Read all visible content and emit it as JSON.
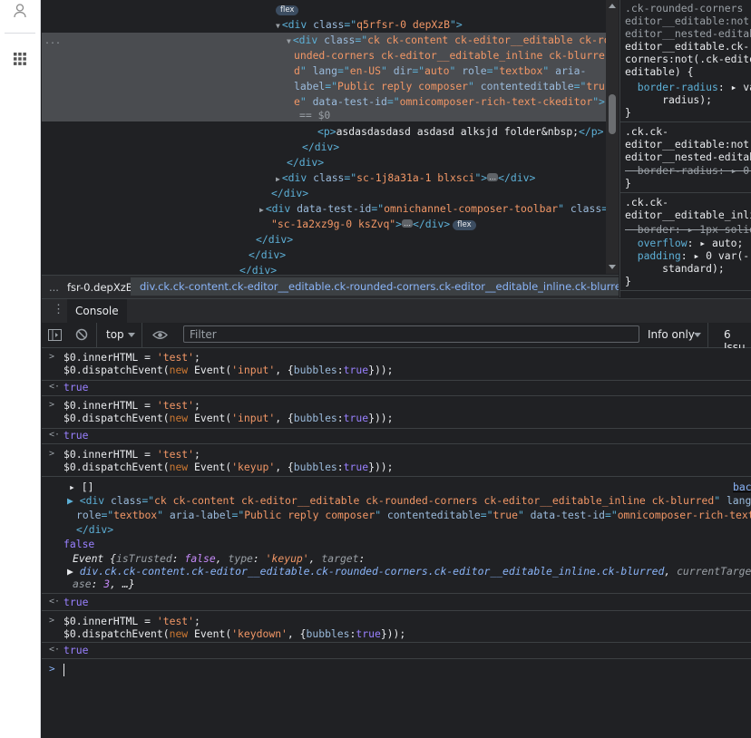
{
  "elements": {
    "lines": [
      {
        "indent": "",
        "pre": "",
        "parts": [],
        "badge": "flex"
      },
      {
        "indent": "",
        "pre": "▼",
        "parts": [
          [
            "tag",
            "<div "
          ],
          [
            "attr",
            "class"
          ],
          [
            "tag",
            "=\""
          ],
          [
            "val",
            "q5rfsr-0 depXzB"
          ],
          [
            "tag",
            "\">"
          ]
        ]
      },
      {
        "indent": "",
        "pre": "▼",
        "parts": [
          [
            "tag",
            "<div "
          ],
          [
            "attr",
            "class"
          ],
          [
            "tag",
            "=\""
          ],
          [
            "val",
            "ck ck-content ck-editor__editable ck-ro"
          ]
        ]
      },
      {
        "indent": "",
        "pre": "",
        "parts": [
          [
            "val",
            "unded-corners ck-editor__editable_inline ck-blurre"
          ]
        ]
      },
      {
        "indent": "",
        "pre": "",
        "parts": [
          [
            "val",
            "d"
          ],
          [
            "tag",
            "\" "
          ],
          [
            "attr",
            "lang"
          ],
          [
            "tag",
            "=\""
          ],
          [
            "val",
            "en-US"
          ],
          [
            "tag",
            "\" "
          ],
          [
            "attr",
            "dir"
          ],
          [
            "tag",
            "=\""
          ],
          [
            "val",
            "auto"
          ],
          [
            "tag",
            "\" "
          ],
          [
            "attr",
            "role"
          ],
          [
            "tag",
            "=\""
          ],
          [
            "val",
            "textbox"
          ],
          [
            "tag",
            "\" "
          ],
          [
            "attr",
            "aria-"
          ]
        ]
      },
      {
        "indent": "",
        "pre": "",
        "parts": [
          [
            "attr",
            "label"
          ],
          [
            "tag",
            "=\""
          ],
          [
            "val",
            "Public reply composer"
          ],
          [
            "tag",
            "\" "
          ],
          [
            "attr",
            "contenteditable"
          ],
          [
            "tag",
            "=\""
          ],
          [
            "val",
            "tru"
          ]
        ]
      },
      {
        "indent": "",
        "pre": "",
        "parts": [
          [
            "val",
            "e"
          ],
          [
            "tag",
            "\" "
          ],
          [
            "attr",
            "data-test-id"
          ],
          [
            "tag",
            "=\""
          ],
          [
            "val",
            "omnicomposer-rich-text-ckeditor"
          ],
          [
            "tag",
            "\">"
          ]
        ]
      },
      {
        "indent": "",
        "pre": "",
        "parts": [
          [
            "cm",
            "== $0"
          ]
        ]
      },
      {
        "indent": "",
        "pre": "",
        "parts": [
          [
            "tag",
            "<p>"
          ],
          [
            "txt",
            "asdasdasdasd asdasd alksjd folder&nbsp;"
          ],
          [
            "tag",
            "</p>"
          ]
        ]
      },
      {
        "indent": "",
        "pre": "",
        "parts": [
          [
            "tag",
            "</div>"
          ]
        ]
      },
      {
        "indent": "",
        "pre": "",
        "parts": [
          [
            "tag",
            "</div>"
          ]
        ]
      },
      {
        "indent": "",
        "pre": "▶",
        "parts": [
          [
            "tag",
            "<div "
          ],
          [
            "attr",
            "class"
          ],
          [
            "tag",
            "=\""
          ],
          [
            "val",
            "sc-1j8a31a-1 blxsci"
          ],
          [
            "tag",
            "\">"
          ]
        ],
        "ell": true,
        "after": [
          [
            "tag",
            "</div>"
          ]
        ]
      },
      {
        "indent": "",
        "pre": "",
        "parts": [
          [
            "tag",
            "</div>"
          ]
        ]
      },
      {
        "indent": "",
        "pre": "▶",
        "parts": [
          [
            "tag",
            "<div "
          ],
          [
            "attr",
            "data-test-id"
          ],
          [
            "tag",
            "=\""
          ],
          [
            "val",
            "omnichannel-composer-toolbar"
          ],
          [
            "tag",
            "\" "
          ],
          [
            "attr",
            "class"
          ],
          [
            "tag",
            "="
          ]
        ]
      },
      {
        "indent": "",
        "pre": "",
        "parts": [
          [
            "val",
            "\"sc-1a2xz9g-0 ksZvq\""
          ],
          [
            "tag",
            ">"
          ]
        ],
        "ell": true,
        "after": [
          [
            "tag",
            "</div>"
          ]
        ],
        "badge": "flex"
      },
      {
        "indent": "",
        "pre": "",
        "parts": [
          [
            "tag",
            "</div>"
          ]
        ]
      },
      {
        "indent": "",
        "pre": "",
        "parts": [
          [
            "tag",
            "</div>"
          ]
        ]
      },
      {
        "indent": "",
        "pre": "",
        "parts": [
          [
            "tag",
            "</div>"
          ]
        ]
      }
    ],
    "row_dots": "...",
    "ellipsis": "…"
  },
  "breadcrumbs": {
    "dots": "...",
    "items": [
      "fsr-0.depXzB",
      "div.ck.ck-content.ck-editor__editable.ck-rounded-corners.ck-editor__editable_inline.ck-blurred"
    ]
  },
  "styles": {
    "lines": [
      {
        "cls": "sel-g",
        "t": ".ck-rounded-corners ."
      },
      {
        "cls": "sel-g",
        "t": "editor__editable:not("
      },
      {
        "cls": "sel-g",
        "t": "editor__nested-editab"
      },
      {
        "cls": "sel-w",
        "t": "editor__editable.ck-r"
      },
      {
        "cls": "sel-w",
        "t": "corners:not(.ck-edito"
      },
      {
        "cls": "sel-w",
        "t": "editable) {"
      },
      {
        "cls": "prop",
        "t": "  border-radius: ▸ var"
      },
      {
        "cls": "prop",
        "t": "      radius);"
      },
      {
        "cls": "sel-w",
        "t": "}"
      },
      {
        "cls": "sel-w",
        "t": ".ck.ck-"
      },
      {
        "cls": "sel-w",
        "t": "editor__editable:not("
      },
      {
        "cls": "sel-w",
        "t": "editor__nested-editab"
      },
      {
        "cls": "strike",
        "t": "  border-radius: ▸ 0;"
      },
      {
        "cls": "sel-w",
        "t": "}"
      },
      {
        "cls": "sel-w",
        "t": ".ck.ck-"
      },
      {
        "cls": "sel-w",
        "t": "editor__editable_inli"
      },
      {
        "cls": "strike",
        "t": "  border: ▸ 1px solid"
      },
      {
        "cls": "prop",
        "t": "  overflow: ▸ auto;"
      },
      {
        "cls": "prop",
        "t": "  padding: ▸ 0 var(--"
      },
      {
        "cls": "prop",
        "t": "      standard);"
      },
      {
        "cls": "sel-w",
        "t": "}"
      }
    ]
  },
  "drawer": {
    "dots": "⋮",
    "tab": "Console"
  },
  "toolbar": {
    "context": "top",
    "filter_placeholder": "Filter",
    "level": "Info only",
    "issues": "6 Issu"
  },
  "console": {
    "entries": [
      {
        "kind": "in",
        "lines": [
          [
            [
              "prop",
              "$0.innerHTML = "
            ],
            [
              "str",
              "'test'"
            ],
            [
              "prop",
              ";"
            ]
          ],
          [
            [
              "prop",
              "$0.dispatchEvent("
            ],
            [
              "kw",
              "new "
            ],
            [
              "cls",
              "Event("
            ],
            [
              "str",
              "'input'"
            ],
            [
              "cls",
              ", {"
            ],
            [
              "kwb",
              "bubbles"
            ],
            [
              "cls",
              ":"
            ],
            [
              "bool",
              "true"
            ],
            [
              "cls",
              "}));"
            ]
          ]
        ]
      },
      {
        "kind": "out",
        "text": "true"
      },
      {
        "kind": "in",
        "lines": [
          [
            [
              "prop",
              "$0.innerHTML = "
            ],
            [
              "str",
              "'test'"
            ],
            [
              "prop",
              ";"
            ]
          ],
          [
            [
              "prop",
              "$0.dispatchEvent("
            ],
            [
              "kw",
              "new "
            ],
            [
              "cls",
              "Event("
            ],
            [
              "str",
              "'input'"
            ],
            [
              "cls",
              ", {"
            ],
            [
              "kwb",
              "bubbles"
            ],
            [
              "cls",
              ":"
            ],
            [
              "bool",
              "true"
            ],
            [
              "cls",
              "}));"
            ]
          ]
        ]
      },
      {
        "kind": "out",
        "text": "true"
      },
      {
        "kind": "in",
        "lines": [
          [
            [
              "prop",
              "$0.innerHTML = "
            ],
            [
              "str",
              "'test'"
            ],
            [
              "prop",
              ";"
            ]
          ],
          [
            [
              "prop",
              "$0.dispatchEvent("
            ],
            [
              "kw",
              "new "
            ],
            [
              "cls",
              "Event("
            ],
            [
              "str",
              "'keyup'"
            ],
            [
              "cls",
              ", {"
            ],
            [
              "kwb",
              "bubbles"
            ],
            [
              "cls",
              ":"
            ],
            [
              "bool",
              "true"
            ],
            [
              "cls",
              "}));"
            ]
          ]
        ]
      },
      {
        "kind": "in",
        "lines": [
          [
            [
              "prop",
              "$0.dispatchEvent("
            ],
            [
              "kw",
              "new "
            ],
            [
              "cls",
              "Event("
            ],
            [
              "str",
              "'keydown'"
            ],
            [
              "cls",
              ", {"
            ],
            [
              "kwb",
              "bubbles"
            ],
            [
              "cls",
              ":"
            ],
            [
              "bool",
              "true"
            ],
            [
              "cls",
              "}));"
            ]
          ]
        ]
      }
    ],
    "log": {
      "array": "▸ []",
      "source_link": "bac",
      "div_line1": [
        [
          "tag",
          "▶ <div "
        ],
        [
          "attr",
          "class"
        ],
        [
          "tag",
          "=\""
        ],
        [
          "val",
          "ck ck-content ck-editor__editable ck-rounded-corners ck-editor__editable_inline ck-blurred"
        ],
        [
          "tag",
          "\" "
        ],
        [
          "attr",
          "lang"
        ],
        [
          "tag",
          "=\""
        ],
        [
          "val",
          "en-"
        ]
      ],
      "div_line2": [
        [
          "attr",
          "role"
        ],
        [
          "tag",
          "=\""
        ],
        [
          "val",
          "textbox"
        ],
        [
          "tag",
          "\" "
        ],
        [
          "attr",
          "aria-label"
        ],
        [
          "tag",
          "=\""
        ],
        [
          "val",
          "Public reply composer"
        ],
        [
          "tag",
          "\" "
        ],
        [
          "attr",
          "contenteditable"
        ],
        [
          "tag",
          "=\""
        ],
        [
          "val",
          "true"
        ],
        [
          "tag",
          "\" "
        ],
        [
          "attr",
          "data-test-id"
        ],
        [
          "tag",
          "=\""
        ],
        [
          "val",
          "omnicomposer-rich-text-ckec"
        ]
      ],
      "div_close": "</div>",
      "false": "false",
      "event1": [
        [
          "prop",
          "Event "
        ],
        [
          "prop",
          "{"
        ],
        [
          "ikey",
          "isTrusted"
        ],
        [
          "prop",
          ": "
        ],
        [
          "ival",
          "false"
        ],
        [
          "prop",
          ", "
        ],
        [
          "ikey",
          "type"
        ],
        [
          "prop",
          ": "
        ],
        [
          "str",
          "'keyup'"
        ],
        [
          "prop",
          ", "
        ],
        [
          "ikey",
          "target"
        ],
        [
          "prop",
          ":"
        ]
      ],
      "event2": [
        [
          "prop",
          "▶ "
        ],
        [
          "ilink",
          "div.ck.ck-content.ck-editor__editable.ck-rounded-corners.ck-editor__editable_inline.ck-blurred"
        ],
        [
          "prop",
          ", "
        ],
        [
          "ikey",
          "currentTarget"
        ],
        [
          "prop",
          ": "
        ],
        [
          "ilink",
          "doc"
        ]
      ],
      "event3": [
        [
          "ikey",
          "ase"
        ],
        [
          "prop",
          ": "
        ],
        [
          "ival",
          "3"
        ],
        [
          "prop",
          ", …}"
        ]
      ],
      "true_after": "true"
    },
    "results": {
      "r1": "true",
      "r2": "true",
      "r4": "true",
      "r5": "true"
    },
    "prompt_in": ">",
    "prompt_out": "<·"
  },
  "colors": {
    "panel_bg": "#202124",
    "selection": "#4a4c50",
    "accent": "#8ab4f8",
    "string": "#f29766",
    "tag": "#5db0d7"
  }
}
